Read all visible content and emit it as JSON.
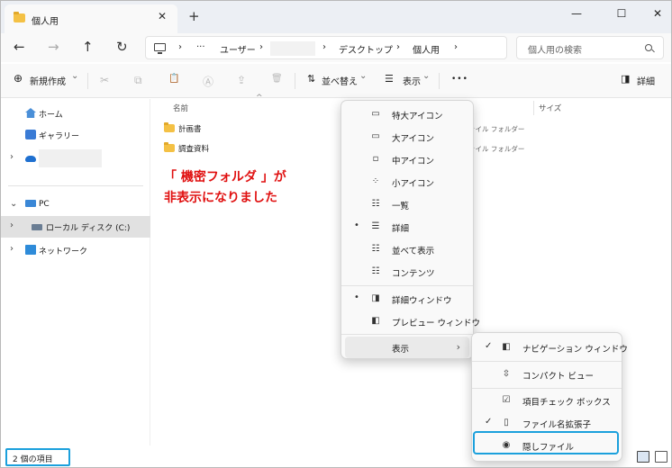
{
  "window": {
    "tab_title": "個人用",
    "tab_close": "✕",
    "tab_new": "+",
    "min_glyph": "—",
    "max_glyph": "☐",
    "close_glyph": "✕"
  },
  "nav": {
    "back": "←",
    "forward": "→",
    "up": "↑",
    "refresh": "↻"
  },
  "address": {
    "sep1": "›",
    "ellipsis": "···",
    "crumb_user": "ユーザー",
    "sep2": "›",
    "sep3": "›",
    "crumb_desktop": "デスクトップ",
    "sep4": "›",
    "crumb_personal": "個人用",
    "sep5": "›"
  },
  "search": {
    "placeholder": "個人用の検索"
  },
  "toolbar": {
    "new_glyph": "⊕",
    "new_label": "新規作成",
    "new_caret": "⌄",
    "cut_glyph": "✂",
    "copy_glyph": "⧉",
    "paste_glyph": "📋",
    "rename_glyph": "Ⓐ",
    "share_glyph": "⇪",
    "delete_glyph": "🗑",
    "sort_glyph": "⇅",
    "sort_label": "並べ替え",
    "sort_caret": "⌄",
    "view_glyph": "☰",
    "view_label": "表示",
    "view_caret": "⌄",
    "more_glyph": "•••",
    "details_glyph": "◨",
    "details_label": "詳細"
  },
  "sidebar": {
    "home": "ホーム",
    "gallery": "ギャラリー",
    "cloud_chev": "›",
    "pc_chev": "⌄",
    "pc": "PC",
    "local_disk_chev": "›",
    "local_disk": "ローカル ディスク (C:)",
    "network_chev": "›",
    "network": "ネットワーク"
  },
  "columns": {
    "name": "名前",
    "sort_glyph": "^",
    "size": "サイズ"
  },
  "files": [
    {
      "name": "計画書",
      "type": "ァイル フォルダー"
    },
    {
      "name": "調査資料",
      "type": "ァイル フォルダー"
    }
  ],
  "annotation": {
    "line1": "「 機密フォルダ 」が",
    "line2": "非表示になりました"
  },
  "status": {
    "count": "2 個の項目"
  },
  "view_menu": {
    "items": [
      {
        "icon": "▭",
        "label": "特大アイコン",
        "check": ""
      },
      {
        "icon": "▭",
        "label": "大アイコン",
        "check": ""
      },
      {
        "icon": "▫",
        "label": "中アイコン",
        "check": ""
      },
      {
        "icon": "⁘",
        "label": "小アイコン",
        "check": ""
      },
      {
        "icon": "☷",
        "label": "一覧",
        "check": ""
      },
      {
        "icon": "☰",
        "label": "詳細",
        "check": "•"
      },
      {
        "icon": "☷",
        "label": "並べて表示",
        "check": ""
      },
      {
        "icon": "☷",
        "label": "コンテンツ",
        "check": ""
      },
      {
        "icon": "◨",
        "label": "詳細ウィンドウ",
        "check": "•"
      },
      {
        "icon": "◧",
        "label": "プレビュー ウィンドウ",
        "check": ""
      },
      {
        "icon": "",
        "label": "表示",
        "check": "",
        "arrow": "›"
      }
    ]
  },
  "submenu": {
    "items": [
      {
        "icon": "◧",
        "label": "ナビゲーション ウィンドウ",
        "check": "✓"
      },
      {
        "icon": "⇳",
        "label": "コンパクト ビュー",
        "check": ""
      },
      {
        "icon": "☑",
        "label": "項目チェック ボックス",
        "check": ""
      },
      {
        "icon": "▯",
        "label": "ファイル名拡張子",
        "check": "✓"
      },
      {
        "icon": "◉",
        "label": "隠しファイル",
        "check": ""
      }
    ]
  },
  "colors": {
    "highlight_border": "#1ba0dc",
    "annotation_red": "#e01010",
    "folder": "#f4c145"
  }
}
